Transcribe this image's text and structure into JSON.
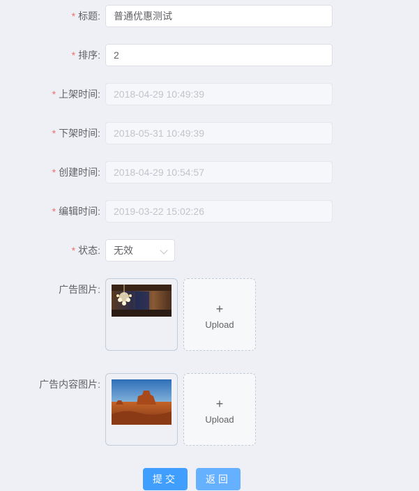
{
  "form": {
    "required_mark": "*",
    "fields": [
      {
        "label": "标题:",
        "value": "普通优惠测试",
        "disabled": false
      },
      {
        "label": "排序:",
        "value": "2",
        "disabled": false
      },
      {
        "label": "上架时间:",
        "value": "2018-04-29 10:49:39",
        "disabled": true
      },
      {
        "label": "下架时间:",
        "value": "2018-05-31 10:49:39",
        "disabled": true
      },
      {
        "label": "创建时间:",
        "value": "2018-04-29 10:54:57",
        "disabled": true
      },
      {
        "label": "编辑时间:",
        "value": "2019-03-22 15:02:26",
        "disabled": true
      }
    ],
    "status": {
      "label": "状态:",
      "value": "无效"
    },
    "ad_image": {
      "label": "广告图片:",
      "upload_label": "Upload",
      "plus": "+"
    },
    "ad_content_image": {
      "label": "广告内容图片:",
      "upload_label": "Upload",
      "plus": "+"
    }
  },
  "actions": {
    "submit_label": "提交",
    "back_label": "返回"
  }
}
